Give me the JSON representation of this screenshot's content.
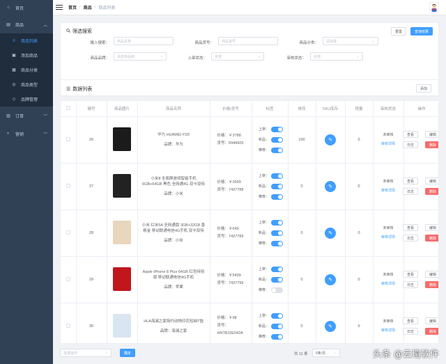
{
  "sidebar": {
    "items": [
      {
        "label": "首页",
        "icon": "home-icon"
      },
      {
        "label": "商品",
        "icon": "goods-icon"
      },
      {
        "label": "订单",
        "icon": "order-icon"
      },
      {
        "label": "营销",
        "icon": "marketing-icon"
      }
    ],
    "sub_items": [
      {
        "label": "商品列表",
        "icon": "list-icon"
      },
      {
        "label": "添加商品",
        "icon": "add-icon"
      },
      {
        "label": "商品分类",
        "icon": "category-icon"
      },
      {
        "label": "商品类型",
        "icon": "type-icon"
      },
      {
        "label": "品牌管理",
        "icon": "brand-icon"
      }
    ]
  },
  "breadcrumb": {
    "home": "首页",
    "goods": "商品",
    "current": "商品列表"
  },
  "filter": {
    "title": "筛选搜索",
    "reset_label": "重置",
    "search_label": "查询结果",
    "keyword_label": "输入搜索：",
    "keyword_placeholder": "商品名称",
    "sn_label": "商品货号：",
    "sn_placeholder": "商品货号",
    "category_label": "商品分类：",
    "category_placeholder": "请选择",
    "brand_label": "商品品牌：",
    "brand_placeholder": "请选择品牌",
    "publish_label": "上架状态：",
    "publish_placeholder": "全部",
    "verify_label": "审核状态：",
    "verify_placeholder": "全部"
  },
  "list": {
    "title": "数据列表",
    "add_label": "添加"
  },
  "table": {
    "headers": [
      "编号",
      "商品图片",
      "商品名称",
      "价格/货号",
      "标签",
      "排序",
      "SKU库存",
      "销量",
      "审核状态",
      "操作"
    ],
    "tag_labels": {
      "publish": "上架：",
      "new": "新品：",
      "recommend": "推荐："
    },
    "price_prefix": "价格：",
    "sn_prefix": "货号：",
    "brand_prefix": "品牌：",
    "audit_link": "审核详情",
    "op_view": "查看",
    "op_edit": "编辑",
    "op_log": "日志",
    "op_delete": "删除",
    "rows": [
      {
        "id": "26",
        "name": "华为 HUAWEI P20",
        "brand": "华为",
        "price": "￥3788",
        "sn": "6946605",
        "sort": "100",
        "sales": "0",
        "audit": "未审核",
        "publish": true,
        "new": true,
        "recommend": true,
        "img_color": "#1b1b1b"
      },
      {
        "id": "27",
        "name": "小米8 全面屏游戏智能手机 6GB+64GB 黑色 全网通4G 双卡双待",
        "brand": "小米",
        "price": "￥2699",
        "sn": "7437788",
        "sort": "0",
        "sales": "0",
        "audit": "未审核",
        "publish": true,
        "new": true,
        "recommend": true,
        "img_color": "#222222"
      },
      {
        "id": "28",
        "name": "小米 红米5A 全网通版 3GB+32GB 香槟金 移动联通电信4G手机 双卡双待",
        "brand": "小米",
        "price": "￥649",
        "sn": "7437789",
        "sort": "0",
        "sales": "0",
        "audit": "未审核",
        "publish": true,
        "new": true,
        "recommend": true,
        "img_color": "#e8d6bd"
      },
      {
        "id": "29",
        "name": "Apple iPhone 8 Plus 64GB 红色特别版 移动联通电信4G手机",
        "brand": "苹果",
        "price": "￥5499",
        "sn": "7437799",
        "sort": "0",
        "sales": "0",
        "audit": "未审核",
        "publish": true,
        "new": true,
        "recommend": false,
        "img_color": "#c0161c"
      },
      {
        "id": "30",
        "name": "HLA海澜之家简约动物印花短袖T恤",
        "brand": "海澜之家",
        "price": "￥98",
        "sn": "HNTBJ2E042A",
        "sort": "0",
        "sales": "0",
        "audit": "未审核",
        "publish": true,
        "new": true,
        "recommend": true,
        "img_color": "#d9e6f2"
      }
    ]
  },
  "footer": {
    "batch_placeholder": "批量操作",
    "confirm_label": "确定",
    "total": "共 11 条",
    "page_size": "5条/页",
    "next_label": "页"
  },
  "watermark": "头条 @云瑄软件",
  "colors": {
    "sidebar": "#304156",
    "primary": "#409eff",
    "danger": "#f56c6c"
  }
}
